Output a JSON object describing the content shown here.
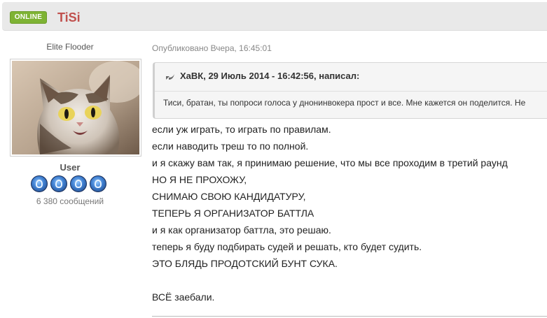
{
  "header": {
    "status_badge": "ONLINE",
    "username": "TiSi"
  },
  "author": {
    "rank_title": "Elite Flooder",
    "group": "User",
    "post_count": "6 380 сообщений",
    "rank_pips": 4
  },
  "post": {
    "date": "Опубликовано Вчера, 16:45:01",
    "quote": {
      "author_line": "ХаВК, 29 Июль 2014 - 16:42:56, написал:",
      "text": "Тиси, братан, ты попроси голоса у днонинвокера прост и все. Мне кажется он поделится. Не"
    },
    "lines": [
      "если уж играть, то играть по правилам.",
      "если наводить треш то по полной.",
      "и я скажу вам так, я принимаю решение, что мы все проходим в третий раунд",
      "НО Я НЕ ПРОХОЖУ,",
      "СНИМАЮ СВОЮ КАНДИДАТУРУ,",
      "ТЕПЕРЬ Я ОРГАНИЗАТОР БАТТЛА",
      "и я как организатор баттла, это решаю.",
      "теперь я буду подбирать судей и решать, кто будет судить.",
      "ЭТО БЛЯДЬ ПРОДОТСКИЙ БУНТ СУКА.",
      "",
      "ВСЁ заебали."
    ]
  },
  "icons": {
    "quote": "quote-arrow-icon",
    "rank_pip": "rank-pip-icon"
  },
  "colors": {
    "online_badge": "#7eb334",
    "username": "#c0504d",
    "header_bg": "#e9e9e9"
  }
}
